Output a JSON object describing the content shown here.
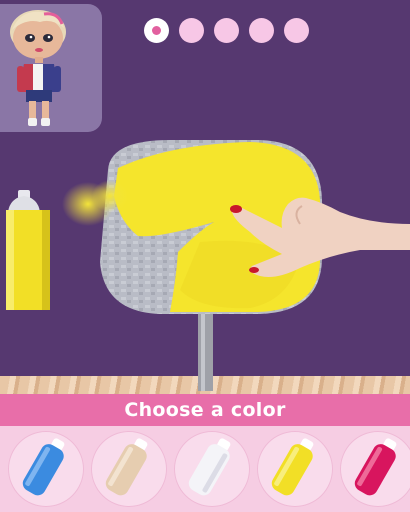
{
  "progress": {
    "total": 5,
    "current": 1
  },
  "prompt": {
    "label": "Choose a color"
  },
  "current_color": "#f4e52e",
  "palette": {
    "colors": [
      {
        "name": "blue",
        "hex": "#3b8be0"
      },
      {
        "name": "beige",
        "hex": "#e6cdb0"
      },
      {
        "name": "white",
        "hex": "#f4f4f8"
      },
      {
        "name": "yellow",
        "hex": "#f2df26"
      },
      {
        "name": "magenta",
        "hex": "#d8155e"
      }
    ]
  }
}
